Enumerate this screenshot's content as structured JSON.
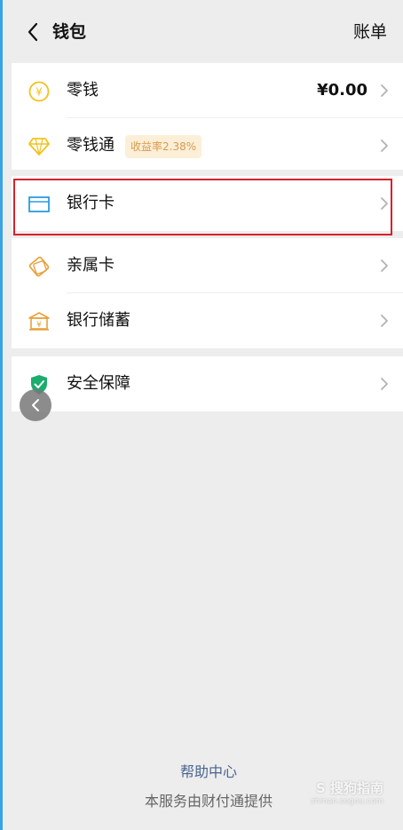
{
  "header": {
    "title": "钱包",
    "right_action": "账单"
  },
  "groups": [
    {
      "rows": [
        {
          "label": "零钱",
          "value": "¥0.00",
          "icon": "yuan-coin-icon"
        },
        {
          "label": "零钱通",
          "badge": "收益率2.38%",
          "icon": "diamond-icon"
        }
      ]
    },
    {
      "rows": [
        {
          "label": "银行卡",
          "icon": "bank-card-icon"
        }
      ]
    },
    {
      "rows": [
        {
          "label": "亲属卡",
          "icon": "family-card-icon"
        },
        {
          "label": "银行储蓄",
          "icon": "bank-savings-icon"
        }
      ]
    },
    {
      "rows": [
        {
          "label": "安全保障",
          "icon": "shield-icon"
        }
      ]
    }
  ],
  "footer": {
    "help_link": "帮助中心",
    "provider_text": "本服务由财付通提供"
  },
  "watermark": {
    "main": "S 搜狗指南",
    "sub": "zhinan.sogou.com"
  },
  "colors": {
    "background": "#ededed",
    "highlight_border": "#d8212b",
    "badge_bg": "#fcefd8",
    "badge_text": "#d99a4d",
    "coin_icon": "#f2c21b",
    "card_icon": "#2b9be0",
    "shield_icon": "#1aad6d",
    "help_link": "#4a6590"
  }
}
